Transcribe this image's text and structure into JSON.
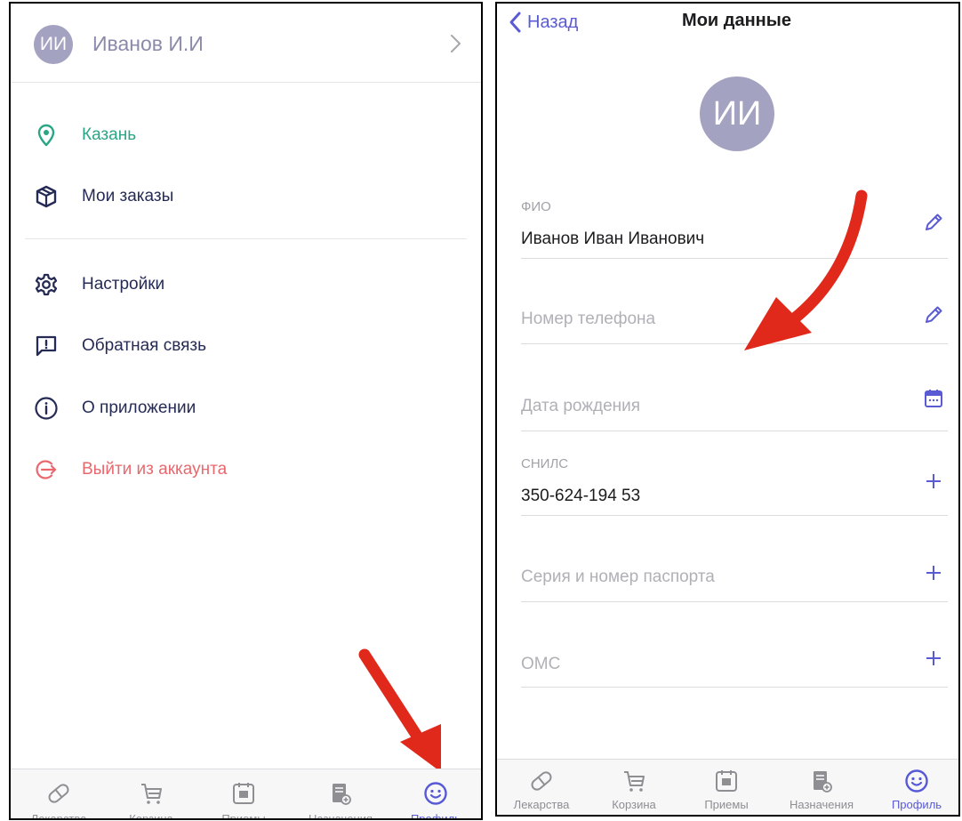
{
  "left": {
    "user": {
      "initials": "ИИ",
      "name": "Иванов И.И"
    },
    "menu": [
      {
        "label": "Казань",
        "icon": "location-pin-icon",
        "color": "#2aa585"
      },
      {
        "label": "Мои заказы",
        "icon": "box-icon",
        "color": "#262b55"
      },
      {
        "label": "Настройки",
        "icon": "gear-icon",
        "color": "#262b55"
      },
      {
        "label": "Обратная связь",
        "icon": "feedback-icon",
        "color": "#262b55"
      },
      {
        "label": "О приложении",
        "icon": "info-icon",
        "color": "#262b55"
      },
      {
        "label": "Выйти из аккаунта",
        "icon": "logout-icon",
        "color": "#e8686e"
      }
    ]
  },
  "tabbar": {
    "tabs": [
      {
        "label": "Лекарства",
        "icon": "pill-icon"
      },
      {
        "label": "Корзина",
        "icon": "cart-icon"
      },
      {
        "label": "Приемы",
        "icon": "calendar-icon"
      },
      {
        "label": "Назначения",
        "icon": "prescription-icon"
      },
      {
        "label": "Профиль",
        "icon": "smiley-icon",
        "active": true
      }
    ],
    "active_color": "#5759d6",
    "inactive_color": "#8e8e93"
  },
  "right": {
    "back_label": "Назад",
    "title": "Мои данные",
    "initials": "ИИ",
    "fields": [
      {
        "caption": "ФИО",
        "value": "Иванов Иван Иванович",
        "action": "pencil-icon"
      },
      {
        "placeholder": "Номер телефона",
        "action": "pencil-icon"
      },
      {
        "placeholder": "Дата рождения",
        "action": "calendar-icon"
      },
      {
        "caption": "СНИЛС",
        "value": "350-624-194 53",
        "action": "plus-icon"
      },
      {
        "placeholder": "Серия и номер паспорта",
        "action": "plus-icon"
      },
      {
        "placeholder": "ОМС",
        "action": "plus-icon"
      }
    ]
  },
  "colors": {
    "accent": "#5a5bd4",
    "avatar": "#a4a2c1",
    "annotation_arrow": "#e0291b"
  }
}
